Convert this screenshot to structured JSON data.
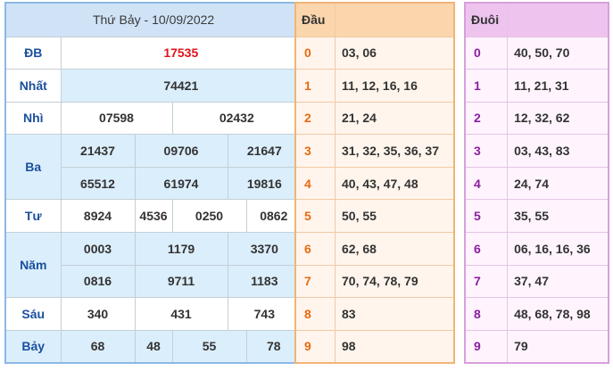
{
  "results": {
    "title": "Thứ Bảy - 10/09/2022",
    "rows": {
      "db": {
        "label": "ĐB",
        "values": [
          "17535"
        ]
      },
      "nhat": {
        "label": "Nhất",
        "values": [
          "74421"
        ]
      },
      "nhi": {
        "label": "Nhì",
        "values": [
          "07598",
          "02432"
        ]
      },
      "ba": {
        "label": "Ba",
        "values": [
          "21437",
          "09706",
          "21647",
          "65512",
          "61974",
          "19816"
        ]
      },
      "tu": {
        "label": "Tư",
        "values": [
          "8924",
          "4536",
          "0250",
          "0862"
        ]
      },
      "nam": {
        "label": "Năm",
        "values": [
          "0003",
          "1179",
          "3370",
          "0816",
          "9711",
          "1183"
        ]
      },
      "sau": {
        "label": "Sáu",
        "values": [
          "340",
          "431",
          "743"
        ]
      },
      "bay": {
        "label": "Bảy",
        "values": [
          "68",
          "48",
          "55",
          "78"
        ]
      }
    }
  },
  "dau": {
    "header": "Đầu",
    "rows": [
      {
        "key": "0",
        "value": "03, 06"
      },
      {
        "key": "1",
        "value": "11, 12, 16, 16"
      },
      {
        "key": "2",
        "value": "21, 24"
      },
      {
        "key": "3",
        "value": "31, 32, 35, 36, 37"
      },
      {
        "key": "4",
        "value": "40, 43, 47, 48"
      },
      {
        "key": "5",
        "value": "50, 55"
      },
      {
        "key": "6",
        "value": "62, 68"
      },
      {
        "key": "7",
        "value": "70, 74, 78, 79"
      },
      {
        "key": "8",
        "value": "83"
      },
      {
        "key": "9",
        "value": "98"
      }
    ]
  },
  "duoi": {
    "header": "Đuôi",
    "rows": [
      {
        "key": "0",
        "value": "40, 50, 70"
      },
      {
        "key": "1",
        "value": "11, 21, 31"
      },
      {
        "key": "2",
        "value": "12, 32, 62"
      },
      {
        "key": "3",
        "value": "03, 43, 83"
      },
      {
        "key": "4",
        "value": "24, 74"
      },
      {
        "key": "5",
        "value": "35, 55"
      },
      {
        "key": "6",
        "value": "06, 16, 16, 36"
      },
      {
        "key": "7",
        "value": "37, 47"
      },
      {
        "key": "8",
        "value": "48, 68, 78, 98"
      },
      {
        "key": "9",
        "value": "79"
      }
    ]
  }
}
